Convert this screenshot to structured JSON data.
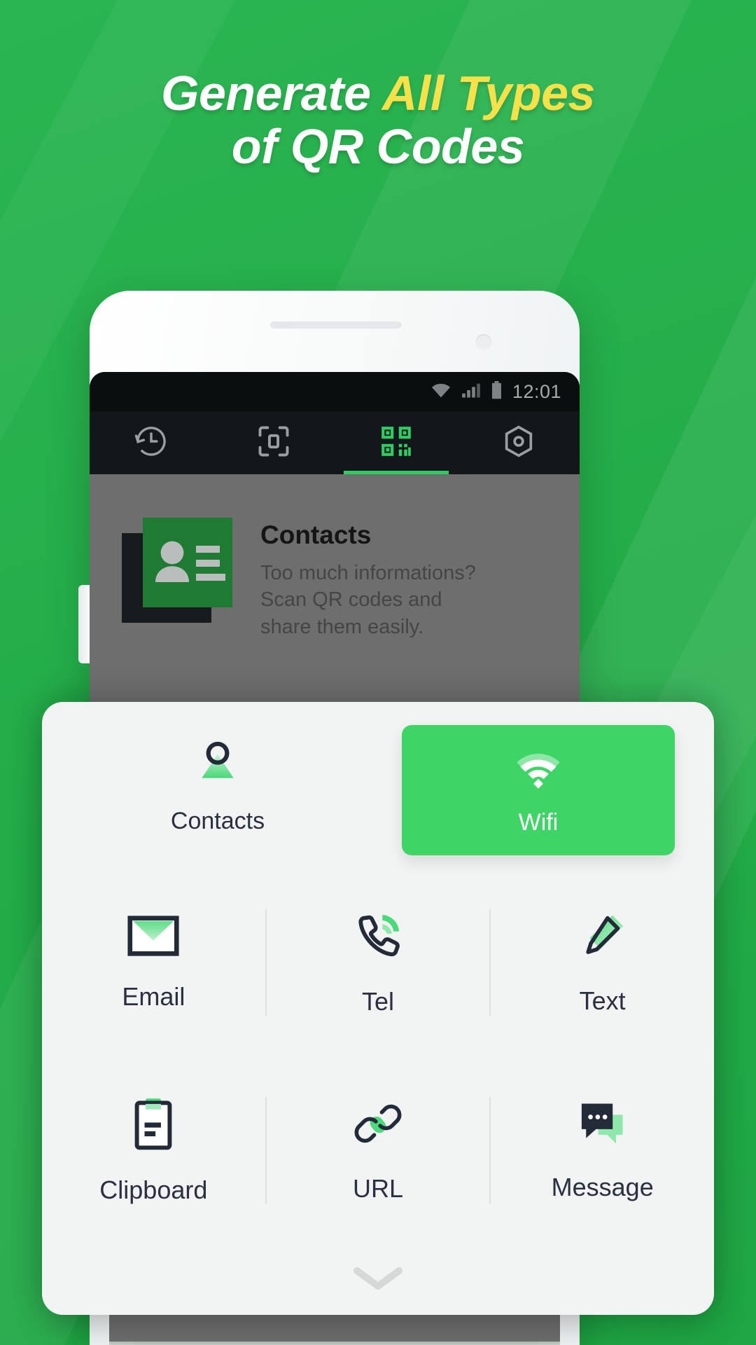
{
  "headline": {
    "line1_white": "Generate ",
    "line1_accent": "All Types",
    "line2": "of QR Codes"
  },
  "colors": {
    "background_green": "#24b14b",
    "accent_yellow": "#f7e14a",
    "selected_green": "#3fd566",
    "icon_dark": "#232a38",
    "icon_green": "#4bd97a"
  },
  "phone": {
    "statusbar": {
      "time": "12:01",
      "wifi_icon": "wifi-icon",
      "signal_icon": "signal-icon",
      "battery_icon": "battery-icon"
    },
    "tabs": [
      {
        "name": "history",
        "icon": "history-clock-icon",
        "active": false
      },
      {
        "name": "scan",
        "icon": "scan-frame-icon",
        "active": false
      },
      {
        "name": "generate",
        "icon": "qr-code-icon",
        "active": true
      },
      {
        "name": "settings",
        "icon": "hexagon-gear-icon",
        "active": false
      }
    ],
    "content": {
      "card": {
        "icon": "contact-card-icon",
        "title": "Contacts",
        "description": "Too much informations? Scan QR codes and share them easily."
      }
    }
  },
  "sheet": {
    "top_row": [
      {
        "id": "contacts",
        "label": "Contacts",
        "icon": "person-icon",
        "selected": false
      },
      {
        "id": "wifi",
        "label": "Wifi",
        "icon": "wifi-signal-icon",
        "selected": true
      }
    ],
    "rows": [
      [
        {
          "id": "email",
          "label": "Email",
          "icon": "envelope-icon"
        },
        {
          "id": "tel",
          "label": "Tel",
          "icon": "phone-icon"
        },
        {
          "id": "text",
          "label": "Text",
          "icon": "pencil-icon"
        }
      ],
      [
        {
          "id": "clipboard",
          "label": "Clipboard",
          "icon": "clipboard-icon"
        },
        {
          "id": "url",
          "label": "URL",
          "icon": "link-icon"
        },
        {
          "id": "message",
          "label": "Message",
          "icon": "chat-bubble-icon"
        }
      ]
    ],
    "handle_icon": "chevron-down-icon"
  }
}
